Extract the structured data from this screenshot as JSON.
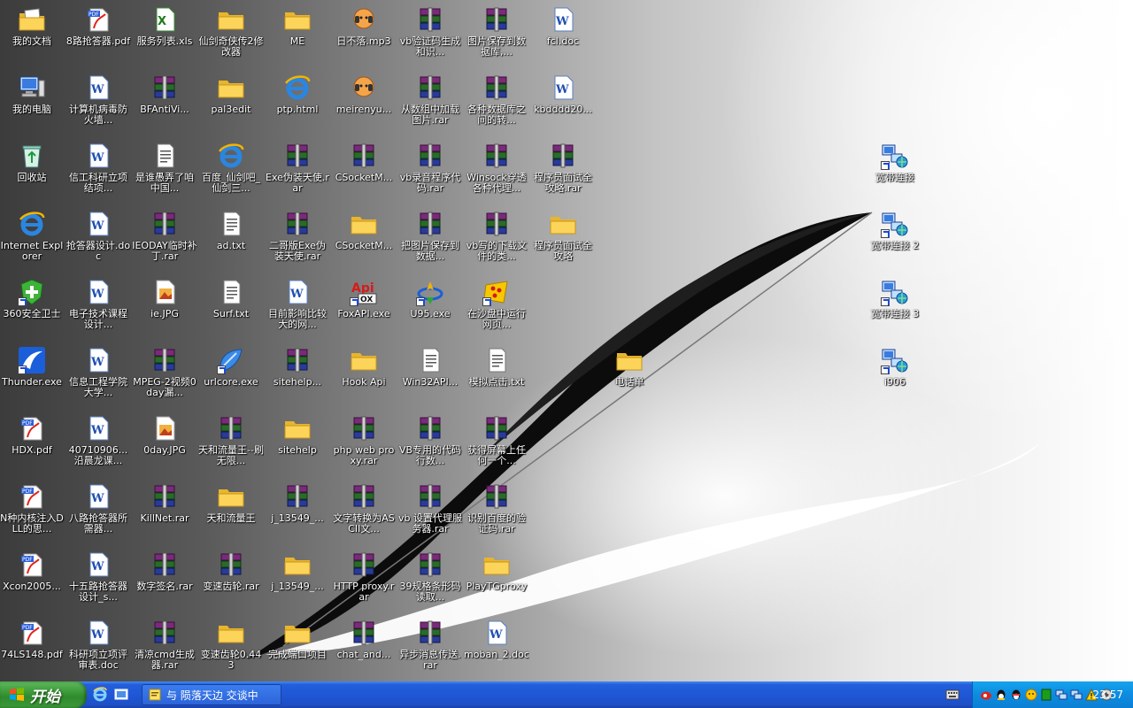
{
  "desktop": {
    "icons": [
      {
        "label": "我的文档",
        "type": "mydocs"
      },
      {
        "label": "8路抢答器.pdf",
        "type": "pdf"
      },
      {
        "label": "服务列表.xls",
        "type": "excel"
      },
      {
        "label": "仙剑奇侠传2修改器",
        "type": "folder"
      },
      {
        "label": "ME",
        "type": "folder"
      },
      {
        "label": "日不落.mp3",
        "type": "mp3"
      },
      {
        "label": "vb验证码生成和识...",
        "type": "rar"
      },
      {
        "label": "图片保存到数据库,...",
        "type": "rar"
      },
      {
        "label": "fcl.doc",
        "type": "doc"
      },
      {
        "label": "我的电脑",
        "type": "computer"
      },
      {
        "label": "计算机病毒防火墙...",
        "type": "doc"
      },
      {
        "label": "BFAntiVi...",
        "type": "rar"
      },
      {
        "label": "pal3edit",
        "type": "folder"
      },
      {
        "label": "ptp.html",
        "type": "ie"
      },
      {
        "label": "meirenyu...",
        "type": "mp3"
      },
      {
        "label": "从数组中加载图片.rar",
        "type": "rar"
      },
      {
        "label": "各种数据库之间的转...",
        "type": "rar"
      },
      {
        "label": "kbdddd20...",
        "type": "doc"
      },
      {
        "label": "回收站",
        "type": "recycle"
      },
      {
        "label": "信工科研立项结项...",
        "type": "doc"
      },
      {
        "label": "是谁愚弄了咱中国...",
        "type": "txt"
      },
      {
        "label": "百度_仙剑吧_仙剑三...",
        "type": "ie"
      },
      {
        "label": "Exe伪装天使.rar",
        "type": "rar"
      },
      {
        "label": "CSocketM...",
        "type": "rar"
      },
      {
        "label": "vb录音程序代码.rar",
        "type": "rar"
      },
      {
        "label": "Winsock穿透各种代理...",
        "type": "rar"
      },
      {
        "label": "程序员面试全攻略.rar",
        "type": "rar"
      },
      {
        "label": "宽带连接",
        "type": "network"
      },
      {
        "label": "Internet Explorer",
        "type": "ie"
      },
      {
        "label": "抢答器设计.doc",
        "type": "doc"
      },
      {
        "label": "IEODAY临时补丁.rar",
        "type": "rar"
      },
      {
        "label": "ad.txt",
        "type": "txt"
      },
      {
        "label": "二哥版Exe伪装天使.rar",
        "type": "rar"
      },
      {
        "label": "CSocketM...",
        "type": "folder"
      },
      {
        "label": "把图片保存到数据...",
        "type": "rar"
      },
      {
        "label": "vb写的下载文件的类...",
        "type": "rar"
      },
      {
        "label": "程序员面试全攻略",
        "type": "folder"
      },
      {
        "label": "宽带连接 2",
        "type": "network"
      },
      {
        "label": "360安全卫士",
        "type": "shield"
      },
      {
        "label": "电子技术课程设计...",
        "type": "doc"
      },
      {
        "label": "ie.JPG",
        "type": "jpg"
      },
      {
        "label": "Surf.txt",
        "type": "txt"
      },
      {
        "label": "目前影响比较大的网...",
        "type": "doc"
      },
      {
        "label": "FoxAPI.exe",
        "type": "api"
      },
      {
        "label": "U95.exe",
        "type": "exe"
      },
      {
        "label": "在沙盘中运行网页...",
        "type": "sandbox"
      },
      {
        "label": "宽带连接 3",
        "type": "network"
      },
      {
        "label": "Thunder.exe",
        "type": "thunder"
      },
      {
        "label": "信息工程学院大学...",
        "type": "doc"
      },
      {
        "label": "MPEG-2视频0day漏...",
        "type": "rar"
      },
      {
        "label": "urlcore.exe",
        "type": "urlcore"
      },
      {
        "label": "sitehelp...",
        "type": "rar"
      },
      {
        "label": "Hook Api",
        "type": "folder"
      },
      {
        "label": "Win32API...",
        "type": "txt"
      },
      {
        "label": "模拟点击.txt",
        "type": "txt"
      },
      {
        "label": "电话单",
        "type": "folder"
      },
      {
        "label": "i906",
        "type": "network"
      },
      {
        "label": "HDX.pdf",
        "type": "pdf"
      },
      {
        "label": "40710906...沿晨龙课...",
        "type": "doc"
      },
      {
        "label": "0day.JPG",
        "type": "jpg"
      },
      {
        "label": "天和流量王--刷无限...",
        "type": "rar"
      },
      {
        "label": "sitehelp",
        "type": "folder"
      },
      {
        "label": "php web proxy.rar",
        "type": "rar"
      },
      {
        "label": "VB专用的代码行数...",
        "type": "rar"
      },
      {
        "label": "获得屏幕上任何一个...",
        "type": "rar"
      },
      {
        "label": "N种内核注入DLL的思...",
        "type": "pdf"
      },
      {
        "label": "八路抢答器所需器...",
        "type": "doc"
      },
      {
        "label": "KillNet.rar",
        "type": "rar"
      },
      {
        "label": "天和流量王",
        "type": "folder"
      },
      {
        "label": "j_13549_...",
        "type": "rar"
      },
      {
        "label": "文字转换为ASCII文...",
        "type": "rar"
      },
      {
        "label": "vb 设置代理服务器.rar",
        "type": "rar"
      },
      {
        "label": "识别百度的验证码.rar",
        "type": "rar"
      },
      {
        "label": "Xcon2005...",
        "type": "pdf"
      },
      {
        "label": "十五路抢答器设计_s...",
        "type": "doc"
      },
      {
        "label": "数字签名.rar",
        "type": "rar"
      },
      {
        "label": "变速齿轮.rar",
        "type": "rar"
      },
      {
        "label": "j_13549_...",
        "type": "folder"
      },
      {
        "label": "HTTP proxy.rar",
        "type": "rar"
      },
      {
        "label": "39规格条形码读取...",
        "type": "rar"
      },
      {
        "label": "PlayTGproxy",
        "type": "folder"
      },
      {
        "label": "74LS148.pdf",
        "type": "pdf"
      },
      {
        "label": "科研项立项评审表.doc",
        "type": "doc"
      },
      {
        "label": "清凉cmd生成器.rar",
        "type": "rar"
      },
      {
        "label": "变速齿轮0.443",
        "type": "folder"
      },
      {
        "label": "完成端口项目",
        "type": "folder"
      },
      {
        "label": "chat_and...",
        "type": "rar"
      },
      {
        "label": "异步消息传送.rar",
        "type": "rar"
      },
      {
        "label": "moban_2.doc",
        "type": "doc"
      }
    ]
  },
  "taskbar": {
    "start_label": "开始",
    "task_label": "与 陨落天边 交谈中",
    "clock": "23:57"
  },
  "colors": {
    "taskbar_blue": "#245edb",
    "start_green": "#3c9a3a",
    "tray_blue": "#0d8ce0"
  }
}
